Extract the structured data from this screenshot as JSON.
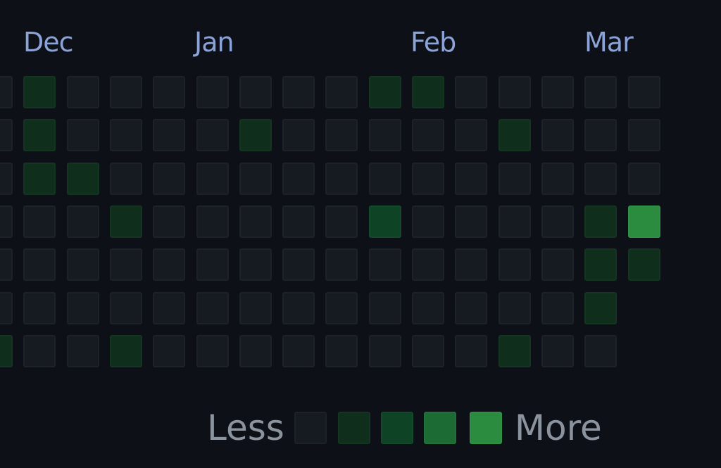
{
  "months": [
    "Dec",
    "Jan",
    "Feb",
    "Mar"
  ],
  "legend": {
    "less_label": "Less",
    "more_label": "More"
  },
  "colors": {
    "background": "#0d1117",
    "month_text": "#8ba3d6",
    "legend_text": "#8b949e",
    "levels": [
      "#161b22",
      "#0f2e1b",
      "#0e4425",
      "#1d6b34",
      "#2b8b3f"
    ]
  },
  "contributions": [
    [
      0,
      1,
      0,
      0,
      0,
      0,
      0,
      0,
      0,
      1,
      1,
      0,
      0,
      0,
      0,
      0
    ],
    [
      0,
      1,
      0,
      0,
      0,
      0,
      1,
      0,
      0,
      0,
      0,
      0,
      1,
      0,
      0,
      0
    ],
    [
      0,
      1,
      1,
      0,
      0,
      0,
      0,
      0,
      0,
      0,
      0,
      0,
      0,
      0,
      0,
      0
    ],
    [
      0,
      0,
      0,
      1,
      0,
      0,
      0,
      0,
      0,
      2,
      0,
      0,
      0,
      0,
      1,
      4
    ],
    [
      0,
      0,
      0,
      0,
      0,
      0,
      0,
      0,
      0,
      0,
      0,
      0,
      0,
      0,
      1,
      1
    ],
    [
      0,
      0,
      0,
      0,
      0,
      0,
      0,
      0,
      0,
      0,
      0,
      0,
      0,
      0,
      1,
      null
    ],
    [
      1,
      0,
      0,
      1,
      0,
      0,
      0,
      0,
      0,
      0,
      0,
      0,
      1,
      0,
      0,
      null
    ]
  ]
}
